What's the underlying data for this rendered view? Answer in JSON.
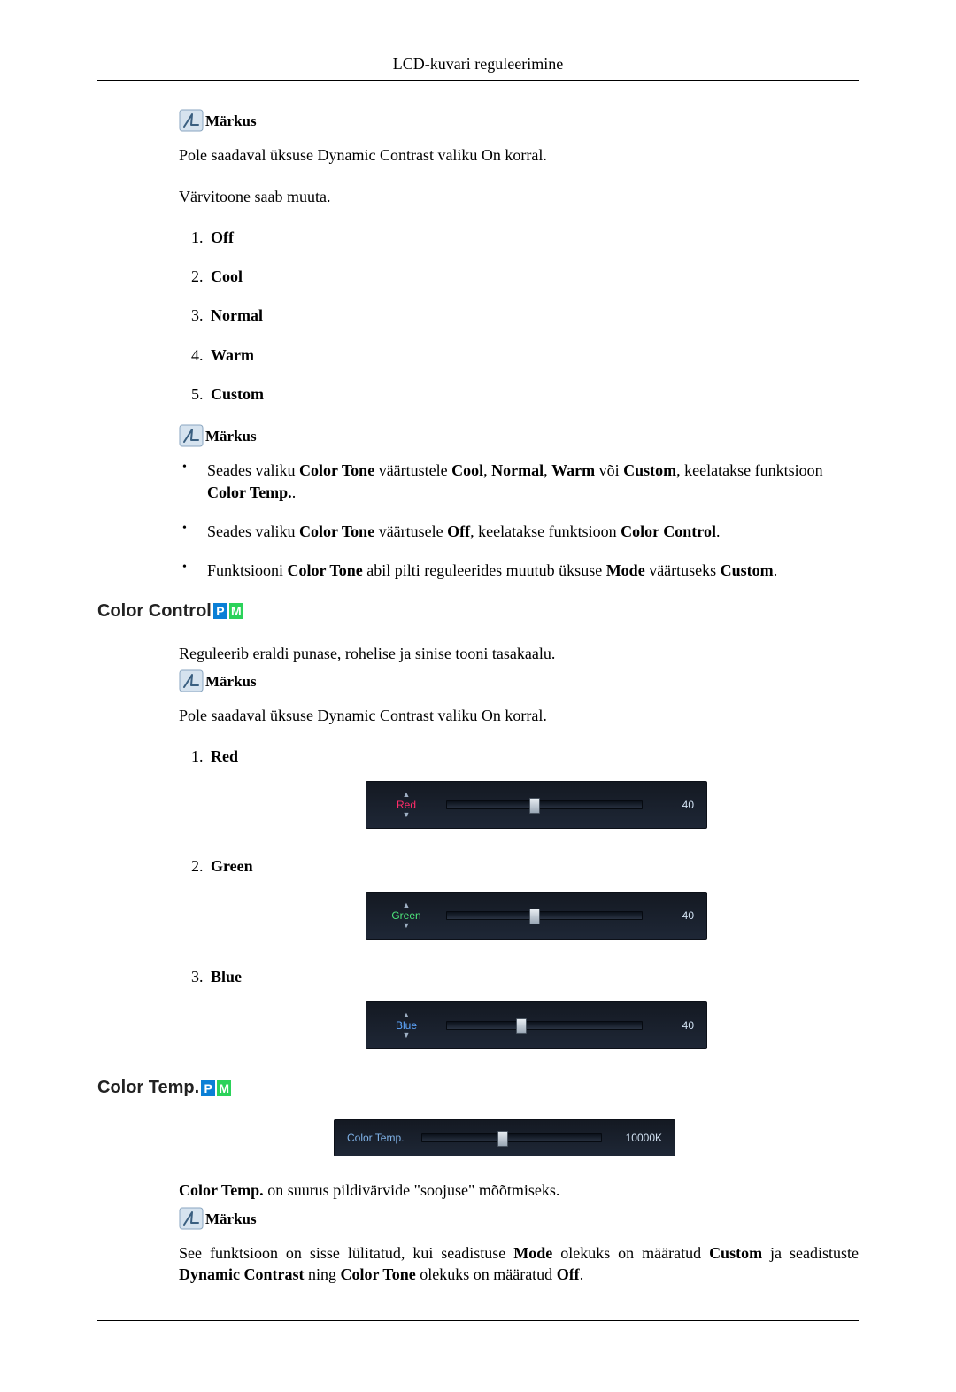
{
  "header": {
    "title": "LCD-kuvari reguleerimine"
  },
  "note_label": "Märkus",
  "intro1": "Pole saadaval üksuse Dynamic Contrast valiku On korral.",
  "intro2": "Värvitoone saab muuta.",
  "tone_list": {
    "i1": "Off",
    "i2": "Cool",
    "i3": "Normal",
    "i4": "Warm",
    "i5": "Custom"
  },
  "notes_section1": {
    "b1_pre": "Seades valiku ",
    "b1_ct": "Color Tone",
    "b1_mid": " väärtustele ",
    "b1_v": "Cool",
    "b1_c1": ", ",
    "b1_v2": "Normal",
    "b1_c2": ", ",
    "b1_v3": "Warm",
    "b1_or": " või ",
    "b1_v4": "Custom",
    "b1_post": ", keelatakse funktsioon ",
    "b1_ct2": "Color Temp.",
    "b1_end": ".",
    "b2_pre": "Seades valiku ",
    "b2_ct": "Color Tone",
    "b2_mid": " väärtusele ",
    "b2_v": "Off",
    "b2_post": ", keelatakse funktsioon ",
    "b2_cc": "Color Control",
    "b2_end": ".",
    "b3_pre": "Funktsiooni ",
    "b3_ct": "Color Tone",
    "b3_mid": " abil pilti reguleerides muutub üksuse ",
    "b3_mode": "Mode",
    "b3_mid2": " väärtuseks ",
    "b3_v": "Custom",
    "b3_end": "."
  },
  "color_control": {
    "heading": "Color Control",
    "tag_p": "P",
    "tag_m": "M",
    "intro": "Reguleerib eraldi punase, rohelise ja sinise tooni tasakaalu.",
    "not_available": "Pole saadaval üksuse Dynamic Contrast valiku On korral.",
    "items": {
      "i1": {
        "label": "Red",
        "slider_label": "Red",
        "value": "40"
      },
      "i2": {
        "label": "Green",
        "slider_label": "Green",
        "value": "40"
      },
      "i3": {
        "label": "Blue",
        "slider_label": "Blue",
        "value": "40"
      }
    }
  },
  "color_temp": {
    "heading": "Color Temp.",
    "tag_p": "P",
    "tag_m": "M",
    "slider_label": "Color Temp.",
    "slider_value": "10000K",
    "desc_pre": "Color Temp.",
    "desc_rest": " on suurus pildivärvide \"soojuse\" mõõtmiseks.",
    "note_pre": "See funktsioon on sisse lülitatud, kui seadistuse ",
    "note_mode": "Mode",
    "note_mid1": " olekuks on määratud ",
    "note_custom": "Custom",
    "note_mid2": " ja seadistuste ",
    "note_dc": "Dynamic Contrast",
    "note_and": " ning ",
    "note_ct": "Color Tone",
    "note_mid3": " olekuks on määratud ",
    "note_off": "Off",
    "note_end": "."
  }
}
